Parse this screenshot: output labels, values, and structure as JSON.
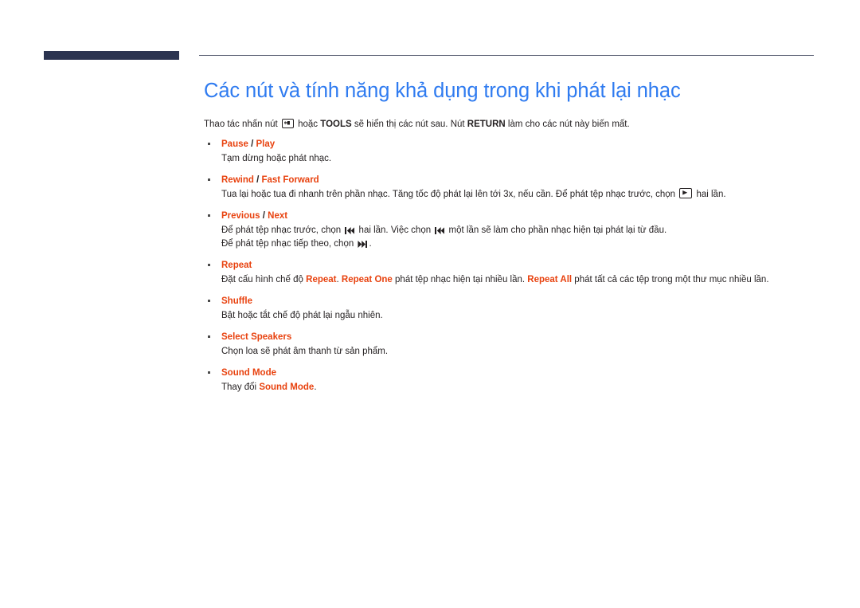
{
  "colors": {
    "title": "#2f7bf0",
    "heading_accent": "#e8420f",
    "header_bar": "#2b3350",
    "rule": "#555a6e",
    "body_text": "#231f20"
  },
  "header": {
    "bar_label": "header-accent-bar",
    "rule_label": "header-rule"
  },
  "title": "Các nút và tính năng khả dụng trong khi phát lại nhạc",
  "intro": {
    "part1": "Thao tác nhấn nút",
    "icon": "enter-key-icon",
    "part2": "hoặc",
    "bold1": "TOOLS",
    "part3": "sẽ hiển thị các nút sau. Nút",
    "bold2": "RETURN",
    "part4": "làm cho các nút này biến mất."
  },
  "items": [
    {
      "title_a": "Pause",
      "sep": " / ",
      "title_b": "Play",
      "lines": [
        {
          "text": "Tạm dừng hoặc phát nhạc."
        }
      ]
    },
    {
      "title_a": "Rewind",
      "sep": " / ",
      "title_b": "Fast Forward",
      "lines": [
        {
          "pre": "Tua lại hoặc tua đi nhanh trên phần nhạc. Tăng tốc độ phát lại lên tới 3x, nếu cần. Để phát tệp nhạc trước, chọn",
          "icon": "boxed-play-icon",
          "post": "hai lần."
        }
      ]
    },
    {
      "title_a": "Previous",
      "sep": " / ",
      "title_b": "Next",
      "lines": [
        {
          "pre": "Để phát tệp nhạc trước, chọn",
          "icon": "previous-track-icon",
          "mid": "hai lần. Việc chọn",
          "icon2": "previous-track-icon",
          "post": "một lần sẽ làm cho phần nhạc hiện tại phát lại từ đầu."
        },
        {
          "pre": "Để phát tệp nhạc tiếp theo, chọn",
          "icon": "next-track-icon",
          "post": "."
        }
      ]
    },
    {
      "title_a": "Repeat",
      "sep": "",
      "title_b": "",
      "lines": [
        {
          "pre": "Đặt cấu hình chế độ",
          "hl1": "Repeat",
          "mid1": ".",
          "hl2": "Repeat One",
          "mid2": "phát tệp nhạc hiện tại nhiều lần.",
          "hl3": "Repeat All",
          "post": "phát tất cả các tệp trong một thư mục nhiều lần."
        }
      ]
    },
    {
      "title_a": "Shuffle",
      "sep": "",
      "title_b": "",
      "lines": [
        {
          "text": "Bật hoặc tắt chế độ phát lại ngẫu nhiên."
        }
      ]
    },
    {
      "title_a": "Select Speakers",
      "sep": "",
      "title_b": "",
      "lines": [
        {
          "text": "Chọn loa sẽ phát âm thanh từ sản phẩm."
        }
      ]
    },
    {
      "title_a": "Sound Mode",
      "sep": "",
      "title_b": "",
      "lines": [
        {
          "pre": "Thay đổi",
          "hl1": "Sound Mode",
          "post": "."
        }
      ]
    }
  ]
}
